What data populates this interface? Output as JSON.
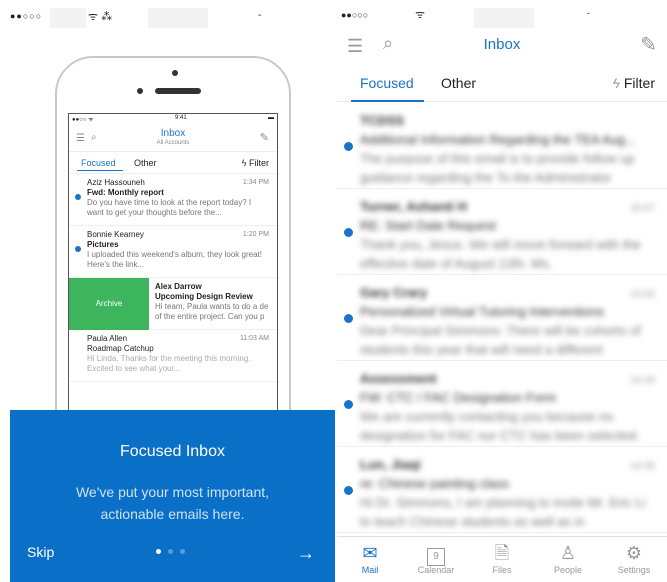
{
  "left": {
    "phone": {
      "status_time": "9:41",
      "inbox_title": "Inbox",
      "inbox_sub": "All Accounts",
      "tabs": {
        "focused": "Focused",
        "other": "Other",
        "filter": "Filter"
      },
      "emails": [
        {
          "sender": "Aziz Hassouneh",
          "time": "1:34 PM",
          "subject": "Fwd: Monthly report",
          "preview": "Do you have time to look at the report today? I want to get your thoughts before the..."
        },
        {
          "sender": "Bonnie Kearney",
          "time": "1:20 PM",
          "subject": "Pictures",
          "preview": "I uploaded this weekend's album, they look great! Here's the link..."
        },
        {
          "sender": "Alex Darrow",
          "time": "",
          "subject": "Upcoming Design Review",
          "preview": "Hi team, Paula wants to do a de of the entire project. Can you p",
          "swipe_action": "Archive"
        },
        {
          "sender": "Paula Allen",
          "time": "11:03 AM",
          "subject": "Roadmap Catchup",
          "preview": "Hi Linda, Thanks for the meeting this morning. Excited to see what your..."
        }
      ]
    },
    "onboarding": {
      "title": "Focused Inbox",
      "text": "We've put your most important, actionable emails here.",
      "skip": "Skip",
      "next_icon": "→"
    }
  },
  "right": {
    "title": "Inbox",
    "tabs": {
      "focused": "Focused",
      "other": "Other",
      "filter": "Filter"
    },
    "emails": [
      {
        "sender": "TCDSS",
        "time": "",
        "subject": "Additional Information Regarding the TEA Aug...",
        "preview": "The purpose of this email is to provide follow up guidance regarding the To the Administrator"
      },
      {
        "sender": "Turner, Ashanti H",
        "time": "15:07",
        "subject": "RE: Start Date Request",
        "preview": "Thank you, Jesus. We will move forward with the effective date of August 12th. Ms."
      },
      {
        "sender": "Gary Crary",
        "time": "14:52",
        "subject": "Personalized Virtual Tutoring Interventions",
        "preview": "Dear Principal Simmons: There will be cohorts of students this year that will need a different"
      },
      {
        "sender": "Assessment",
        "time": "14:43",
        "subject": "FW: CTC / FAC Designation Form",
        "preview": "We are currently contacting you because no designation for FAC nor CTC has been selected."
      },
      {
        "sender": "Lun, Jiaqi",
        "time": "14:35",
        "subject": "re: Chinese painting class",
        "preview": "Hi Dr. Simmons, I am planning to invite Mr. Eric Li to teach Chinese students as well as in"
      }
    ],
    "tabbar": [
      {
        "label": "Mail",
        "icon": "mail-icon"
      },
      {
        "label": "Calendar",
        "icon": "calendar-icon",
        "day": "9"
      },
      {
        "label": "Files",
        "icon": "files-icon"
      },
      {
        "label": "People",
        "icon": "people-icon"
      },
      {
        "label": "Settings",
        "icon": "settings-icon"
      }
    ]
  }
}
